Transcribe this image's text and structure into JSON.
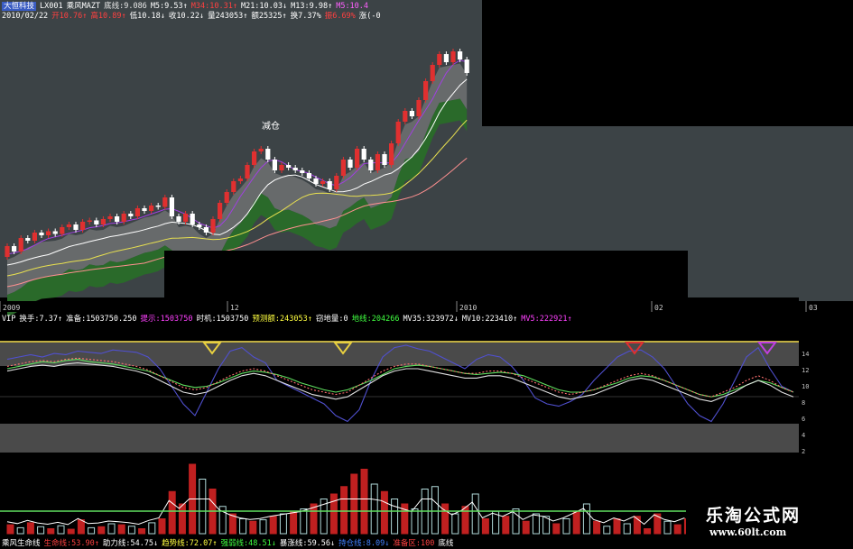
{
  "header": {
    "row1": [
      {
        "text": "大恒科技",
        "color": "#ffffff",
        "bg": "#3a5cc2"
      },
      {
        "text": "LX001",
        "color": "#ffffff"
      },
      {
        "text": "乘风MAZT",
        "color": "#ffffff"
      },
      {
        "text": "底线:9.086",
        "color": "#e8e8e8"
      },
      {
        "text": "M5:9.53↑",
        "color": "#ffffff"
      },
      {
        "text": "M34:10.31↑",
        "color": "#ff4040"
      },
      {
        "text": "M21:10.03↓",
        "color": "#ffffff"
      },
      {
        "text": "M13:9.98↑",
        "color": "#ffffff"
      },
      {
        "text": "M5:10.4",
        "color": "#ff60ff"
      }
    ],
    "row2": [
      {
        "text": "2010/02/22",
        "color": "#ffffff"
      },
      {
        "text": "开10.76↑",
        "color": "#ff4040"
      },
      {
        "text": "高10.89↑",
        "color": "#ff4040"
      },
      {
        "text": "低10.18↓",
        "color": "#ffffff"
      },
      {
        "text": "收10.22↓",
        "color": "#ffffff"
      },
      {
        "text": "量243053↑",
        "color": "#ffffff"
      },
      {
        "text": "额25325↑",
        "color": "#ffffff"
      },
      {
        "text": "换7.37%",
        "color": "#ffffff"
      },
      {
        "text": "振6.69%",
        "color": "#ff4040"
      },
      {
        "text": "涨(-0",
        "color": "#ffffff"
      }
    ],
    "timeline": [
      "2009",
      "12",
      "2010",
      "02",
      "03"
    ],
    "indicator_row": [
      {
        "text": "VIP",
        "color": "#ffffff"
      },
      {
        "text": "换手:7.37↑",
        "color": "#ffffff"
      },
      {
        "text": "准备:1503750.250",
        "color": "#ffffff"
      },
      {
        "text": "提示:1503750",
        "color": "#ff40ff"
      },
      {
        "text": "时机:1503750",
        "color": "#ffffff"
      },
      {
        "text": "预测额:243053↑",
        "color": "#ffff40"
      },
      {
        "text": "窃地量:0",
        "color": "#ffffff"
      },
      {
        "text": "地线:204266",
        "color": "#40ff40"
      },
      {
        "text": "MV35:323972↓",
        "color": "#ffffff"
      },
      {
        "text": "MV10:223410↑",
        "color": "#ffffff"
      },
      {
        "text": "MV5:222921↑",
        "color": "#ff40ff"
      }
    ],
    "bottom_row": [
      {
        "text": "乘风生命线",
        "color": "#ffffff"
      },
      {
        "text": "生命线:53.90↑",
        "color": "#ff4040"
      },
      {
        "text": "助力线:54.75↓",
        "color": "#ffffff"
      },
      {
        "text": "趋势线:72.07↑",
        "color": "#ffff40"
      },
      {
        "text": "强弱线:48.51↓",
        "color": "#40ff40"
      },
      {
        "text": "暴涨线:59.56↓",
        "color": "#ffffff"
      },
      {
        "text": "持仓线:8.09↓",
        "color": "#4080ff"
      },
      {
        "text": "准备区:100",
        "color": "#ff4040"
      },
      {
        "text": "底线",
        "color": "#ffffff"
      }
    ]
  },
  "annotations": {
    "reduce_position": "减仓",
    "y_axis_ticks": [
      "14",
      "12",
      "10",
      "8",
      "6",
      "4",
      "2"
    ]
  },
  "watermark": {
    "title": "乐淘公式网",
    "url": "www.60lt.com"
  },
  "colors": {
    "up": "#e03030",
    "down": "#ffffff",
    "band": "#2a6a2a",
    "gray_band": "#8a8a8a",
    "ma_yellow": "#e8e050",
    "ma_purple": "#a040e0",
    "ma_white": "#ffffff",
    "ma_pink": "#ff9090"
  },
  "chart_data": {
    "type": "candlestick",
    "title": "",
    "candles": [
      {
        "o": 9.0,
        "c": 9.4
      },
      {
        "o": 9.4,
        "c": 9.2
      },
      {
        "o": 9.2,
        "c": 9.7
      },
      {
        "o": 9.7,
        "c": 9.6
      },
      {
        "o": 9.6,
        "c": 9.9
      },
      {
        "o": 9.9,
        "c": 9.8
      },
      {
        "o": 9.8,
        "c": 9.95
      },
      {
        "o": 9.95,
        "c": 9.85
      },
      {
        "o": 9.85,
        "c": 10.1
      },
      {
        "o": 10.1,
        "c": 10.2
      },
      {
        "o": 10.2,
        "c": 10.0
      },
      {
        "o": 10.0,
        "c": 10.3
      },
      {
        "o": 10.3,
        "c": 10.35
      },
      {
        "o": 10.35,
        "c": 10.2
      },
      {
        "o": 10.2,
        "c": 10.4
      },
      {
        "o": 10.4,
        "c": 10.5
      },
      {
        "o": 10.5,
        "c": 10.3
      },
      {
        "o": 10.3,
        "c": 10.6
      },
      {
        "o": 10.6,
        "c": 10.5
      },
      {
        "o": 10.5,
        "c": 10.8
      },
      {
        "o": 10.8,
        "c": 10.7
      },
      {
        "o": 10.7,
        "c": 10.9
      },
      {
        "o": 10.9,
        "c": 10.85
      },
      {
        "o": 10.85,
        "c": 11.2
      },
      {
        "o": 11.2,
        "c": 10.5
      },
      {
        "o": 10.5,
        "c": 10.3
      },
      {
        "o": 10.3,
        "c": 10.6
      },
      {
        "o": 10.6,
        "c": 10.2
      },
      {
        "o": 10.2,
        "c": 10.1
      },
      {
        "o": 10.1,
        "c": 9.9
      },
      {
        "o": 9.9,
        "c": 10.4
      },
      {
        "o": 10.4,
        "c": 11.0
      },
      {
        "o": 11.0,
        "c": 11.4
      },
      {
        "o": 11.4,
        "c": 11.8
      },
      {
        "o": 11.8,
        "c": 11.9
      },
      {
        "o": 11.9,
        "c": 12.4
      },
      {
        "o": 12.4,
        "c": 12.9
      },
      {
        "o": 12.9,
        "c": 13.0
      },
      {
        "o": 13.0,
        "c": 12.6
      },
      {
        "o": 12.6,
        "c": 12.2
      },
      {
        "o": 12.2,
        "c": 12.4
      },
      {
        "o": 12.4,
        "c": 12.3
      },
      {
        "o": 12.3,
        "c": 12.2
      },
      {
        "o": 12.2,
        "c": 12.1
      },
      {
        "o": 12.1,
        "c": 11.9
      },
      {
        "o": 11.9,
        "c": 11.7
      },
      {
        "o": 11.7,
        "c": 11.8
      },
      {
        "o": 11.8,
        "c": 11.5
      },
      {
        "o": 11.5,
        "c": 12.0
      },
      {
        "o": 12.0,
        "c": 12.6
      },
      {
        "o": 12.6,
        "c": 12.3
      },
      {
        "o": 12.3,
        "c": 13.0
      },
      {
        "o": 13.0,
        "c": 12.6
      },
      {
        "o": 12.6,
        "c": 12.2
      },
      {
        "o": 12.2,
        "c": 12.8
      },
      {
        "o": 12.8,
        "c": 12.4
      },
      {
        "o": 12.4,
        "c": 13.2
      },
      {
        "o": 13.2,
        "c": 14.0
      },
      {
        "o": 14.0,
        "c": 14.4
      },
      {
        "o": 14.4,
        "c": 14.2
      },
      {
        "o": 14.2,
        "c": 14.8
      },
      {
        "o": 14.8,
        "c": 15.5
      },
      {
        "o": 15.5,
        "c": 16.1
      },
      {
        "o": 16.1,
        "c": 16.5
      },
      {
        "o": 16.5,
        "c": 16.2
      },
      {
        "o": 16.2,
        "c": 16.6
      },
      {
        "o": 16.6,
        "c": 16.3
      },
      {
        "o": 16.3,
        "c": 15.8
      }
    ],
    "ylim": [
      8.5,
      17.5
    ],
    "osc_purple": [
      78,
      80,
      82,
      80,
      83,
      82,
      85,
      84,
      83,
      86,
      85,
      84,
      80,
      70,
      55,
      40,
      30,
      50,
      70,
      85,
      88,
      80,
      75,
      60,
      55,
      50,
      45,
      40,
      30,
      25,
      35,
      60,
      80,
      88,
      90,
      87,
      85,
      80,
      75,
      70,
      78,
      82,
      80,
      72,
      60,
      45,
      40,
      38,
      42,
      48,
      60,
      70,
      80,
      85,
      86,
      80,
      70,
      55,
      40,
      30,
      25,
      40,
      60,
      80,
      88,
      70,
      55,
      50
    ],
    "osc_green": [
      70,
      72,
      74,
      76,
      75,
      77,
      78,
      76,
      75,
      74,
      72,
      70,
      68,
      64,
      60,
      56,
      54,
      55,
      58,
      62,
      66,
      68,
      67,
      65,
      62,
      58,
      55,
      52,
      50,
      52,
      56,
      60,
      65,
      70,
      72,
      73,
      72,
      70,
      68,
      66,
      65,
      66,
      67,
      66,
      64,
      60,
      56,
      52,
      50,
      50,
      52,
      55,
      58,
      62,
      64,
      63,
      60,
      56,
      52,
      48,
      46,
      48,
      52,
      56,
      60,
      58,
      54,
      50
    ],
    "osc_white": [
      68,
      70,
      72,
      73,
      72,
      74,
      75,
      74,
      73,
      72,
      70,
      68,
      65,
      60,
      55,
      50,
      48,
      50,
      55,
      60,
      64,
      66,
      64,
      60,
      56,
      52,
      48,
      46,
      44,
      46,
      52,
      58,
      64,
      68,
      70,
      70,
      68,
      66,
      64,
      62,
      62,
      64,
      64,
      62,
      58,
      54,
      50,
      46,
      44,
      46,
      48,
      52,
      56,
      60,
      62,
      60,
      56,
      52,
      48,
      44,
      42,
      46,
      50,
      56,
      60,
      56,
      50,
      46
    ],
    "volume": [
      {
        "v": 18,
        "up": true
      },
      {
        "v": 12,
        "up": false
      },
      {
        "v": 22,
        "up": true
      },
      {
        "v": 14,
        "up": false
      },
      {
        "v": 10,
        "up": true
      },
      {
        "v": 16,
        "up": false
      },
      {
        "v": 9,
        "up": true
      },
      {
        "v": 28,
        "up": true
      },
      {
        "v": 12,
        "up": false
      },
      {
        "v": 14,
        "up": true
      },
      {
        "v": 20,
        "up": false
      },
      {
        "v": 18,
        "up": true
      },
      {
        "v": 15,
        "up": false
      },
      {
        "v": 10,
        "up": true
      },
      {
        "v": 22,
        "up": false
      },
      {
        "v": 30,
        "up": true
      },
      {
        "v": 85,
        "up": true
      },
      {
        "v": 60,
        "up": true
      },
      {
        "v": 140,
        "up": true
      },
      {
        "v": 110,
        "up": false
      },
      {
        "v": 90,
        "up": true
      },
      {
        "v": 55,
        "up": false
      },
      {
        "v": 40,
        "up": true
      },
      {
        "v": 30,
        "up": false
      },
      {
        "v": 25,
        "up": true
      },
      {
        "v": 28,
        "up": false
      },
      {
        "v": 35,
        "up": true
      },
      {
        "v": 40,
        "up": false
      },
      {
        "v": 45,
        "up": true
      },
      {
        "v": 50,
        "up": false
      },
      {
        "v": 60,
        "up": true
      },
      {
        "v": 70,
        "up": false
      },
      {
        "v": 80,
        "up": true
      },
      {
        "v": 95,
        "up": true
      },
      {
        "v": 120,
        "up": true
      },
      {
        "v": 130,
        "up": true
      },
      {
        "v": 100,
        "up": false
      },
      {
        "v": 85,
        "up": true
      },
      {
        "v": 70,
        "up": false
      },
      {
        "v": 60,
        "up": true
      },
      {
        "v": 50,
        "up": false
      },
      {
        "v": 90,
        "up": false
      },
      {
        "v": 95,
        "up": false
      },
      {
        "v": 60,
        "up": true
      },
      {
        "v": 40,
        "up": false
      },
      {
        "v": 55,
        "up": true
      },
      {
        "v": 80,
        "up": false
      },
      {
        "v": 30,
        "up": true
      },
      {
        "v": 45,
        "up": false
      },
      {
        "v": 35,
        "up": true
      },
      {
        "v": 50,
        "up": false
      },
      {
        "v": 25,
        "up": true
      },
      {
        "v": 40,
        "up": false
      },
      {
        "v": 35,
        "up": false
      },
      {
        "v": 20,
        "up": true
      },
      {
        "v": 30,
        "up": false
      },
      {
        "v": 45,
        "up": true
      },
      {
        "v": 60,
        "up": false
      },
      {
        "v": 25,
        "up": true
      },
      {
        "v": 15,
        "up": false
      },
      {
        "v": 30,
        "up": true
      },
      {
        "v": 20,
        "up": false
      },
      {
        "v": 35,
        "up": true
      },
      {
        "v": 10,
        "up": true
      },
      {
        "v": 40,
        "up": true
      },
      {
        "v": 25,
        "up": false
      },
      {
        "v": 18,
        "up": true
      },
      {
        "v": 30,
        "up": true
      }
    ]
  }
}
